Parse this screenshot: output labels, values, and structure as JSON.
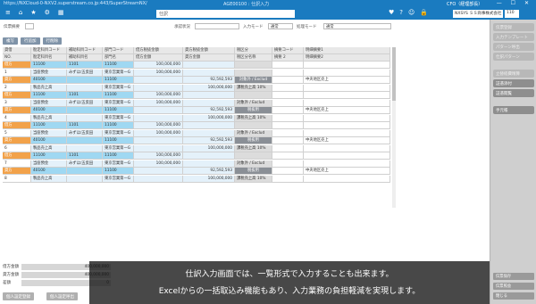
{
  "window": {
    "url": "https://NXCloud-0-NXV2.superstream.co.jp:443/SuperStreamNX/",
    "title": "AGE00100 : 仕訳入力",
    "app_title": "CFO（経理部長）",
    "controls": "— ☐ ✕"
  },
  "toolbar": {
    "icons": [
      "grid-icon",
      "home-icon",
      "star-icon",
      "gear-icon",
      "list-icon"
    ],
    "icon_glyphs": [
      "≡",
      "⌂",
      "★",
      "⚙",
      "▦"
    ],
    "tab_text": "仕訳",
    "right_icons": [
      "heart-icon",
      "help-icon",
      "user-icon",
      "lock-icon"
    ],
    "right_glyphs": [
      "♥",
      "?",
      "☺",
      "🔒"
    ],
    "company": "NXSYS ＳＳ商事株式会社",
    "zoom": "110"
  },
  "header": {
    "date_label": "伝票摘要",
    "status_label": "承認状況",
    "input_mode_label": "入力モード",
    "input_mode_value": "通常",
    "process_mode_label": "処理モード",
    "process_mode_value": "通常"
  },
  "actions": {
    "copy": "複写",
    "add_row": "行追加",
    "delete_row": "行削除"
  },
  "table": {
    "headers1": [
      "貸借",
      "勘定科目コード",
      "補助科目コード",
      "部門コード",
      "借方税抜金額",
      "貸方税抜金額",
      "税区分",
      "摘要コード",
      "明細摘要1"
    ],
    "headers2": [
      "NO.",
      "勘定科目名",
      "補助科目名",
      "部門名",
      "借方金額",
      "貸方金額",
      "税区分名称",
      "摘要 2",
      "明細摘要2"
    ],
    "rows": [
      {
        "no": "",
        "dc": "借方",
        "acct": "11100",
        "sub": "1101",
        "dept": "11100",
        "debit": "100,000,000",
        "credit": "",
        "tax": "",
        "memo": ""
      },
      {
        "no": "1",
        "dc": "",
        "acct": "当座預金",
        "sub": "みずほ/五反田",
        "dept": "東京営業第一G",
        "debit": "100,000,000",
        "credit": "",
        "tax": "",
        "memo": ""
      },
      {
        "no": "",
        "dc": "貸方",
        "acct": "40100",
        "sub": "",
        "dept": "11100",
        "debit": "",
        "credit": "92,592,593",
        "tax": "対象外 / Exclud",
        "memo": "中央地区売上"
      },
      {
        "no": "2",
        "dc": "",
        "acct": "製品売上高",
        "sub": "",
        "dept": "東京営業第一G",
        "debit": "",
        "credit": "100,000,000",
        "tax": "課税売上高 10%",
        "memo": ""
      },
      {
        "no": "",
        "dc": "借方",
        "acct": "11100",
        "sub": "1101",
        "dept": "11100",
        "debit": "100,000,000",
        "credit": "",
        "tax": "",
        "memo": ""
      },
      {
        "no": "3",
        "dc": "",
        "acct": "当座預金",
        "sub": "みずほ/五反田",
        "dept": "東京営業第一G",
        "debit": "100,000,000",
        "credit": "",
        "tax": "対象外 / Exclud",
        "memo": ""
      },
      {
        "no": "",
        "dc": "貸方",
        "acct": "40100",
        "sub": "",
        "dept": "11100",
        "debit": "",
        "credit": "92,592,593",
        "tax": "税抜用",
        "memo": "中央地区売上"
      },
      {
        "no": "4",
        "dc": "",
        "acct": "製品売上高",
        "sub": "",
        "dept": "東京営業第一G",
        "debit": "",
        "credit": "100,000,000",
        "tax": "課税売上高 10%",
        "memo": ""
      },
      {
        "no": "",
        "dc": "借方",
        "acct": "11100",
        "sub": "1101",
        "dept": "11100",
        "debit": "100,000,000",
        "credit": "",
        "tax": "",
        "memo": ""
      },
      {
        "no": "5",
        "dc": "",
        "acct": "当座預金",
        "sub": "みずほ/五反田",
        "dept": "東京営業第一G",
        "debit": "100,000,000",
        "credit": "",
        "tax": "対象外 / Exclud",
        "memo": ""
      },
      {
        "no": "",
        "dc": "貸方",
        "acct": "40100",
        "sub": "",
        "dept": "11100",
        "debit": "",
        "credit": "92,592,593",
        "tax": "税抜用",
        "memo": "中央地区売上"
      },
      {
        "no": "6",
        "dc": "",
        "acct": "製品売上高",
        "sub": "",
        "dept": "東京営業第一G",
        "debit": "",
        "credit": "100,000,000",
        "tax": "課税売上高 10%",
        "memo": ""
      },
      {
        "no": "",
        "dc": "借方",
        "acct": "11100",
        "sub": "1101",
        "dept": "11100",
        "debit": "100,000,000",
        "credit": "",
        "tax": "",
        "memo": ""
      },
      {
        "no": "7",
        "dc": "",
        "acct": "当座預金",
        "sub": "みずほ/五反田",
        "dept": "東京営業第一G",
        "debit": "100,000,000",
        "credit": "",
        "tax": "対象外 / Exclud",
        "memo": ""
      },
      {
        "no": "",
        "dc": "貸方",
        "acct": "40100",
        "sub": "",
        "dept": "11100",
        "debit": "",
        "credit": "92,592,593",
        "tax": "税抜用",
        "memo": "中央地区売上"
      },
      {
        "no": "8",
        "dc": "",
        "acct": "製品売上高",
        "sub": "",
        "dept": "東京営業第一G",
        "debit": "",
        "credit": "100,000,000",
        "tax": "課税売上高 10%",
        "memo": ""
      }
    ]
  },
  "sidebar": {
    "items": [
      "伝票登録",
      "入力テンプレート",
      "パターン呼出",
      "仕訳パターン",
      "立替経費精算",
      "証憑添付",
      "証憑閲覧",
      "手元帳"
    ],
    "bottom": [
      "伝票保存",
      "伝票照会",
      "閉じる"
    ]
  },
  "summary": {
    "debit_label": "借方金額",
    "debit_value": "400,000,000",
    "credit_label": "貸方金額",
    "credit_value": "400,000,000",
    "diff_label": "差額",
    "diff_value": "0"
  },
  "bottom_buttons": [
    "個人設定登録",
    "個人設定呼出"
  ],
  "subtitles": [
    "仕訳入力画面では、一覧形式で入力することも出来ます。",
    "Excelからの一括取込み機能もあり、入力業務の負担軽減を実現します。"
  ]
}
